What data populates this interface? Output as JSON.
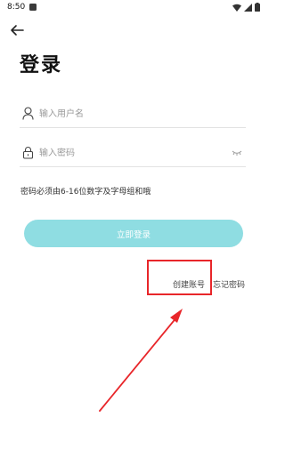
{
  "status_bar": {
    "time": "8:50"
  },
  "login": {
    "title": "登录",
    "username_placeholder": "输入用户名",
    "password_placeholder": "输入密码",
    "password_hint": "密码必须由6-16位数字及字母组和哦",
    "submit_label": "立即登录",
    "create_account_label": "创建账号",
    "forgot_password_label": "忘记密码"
  },
  "icons": {
    "back": "arrow-left-icon",
    "user": "user-icon",
    "lock": "lock-icon",
    "eye": "eye-closed-icon"
  },
  "colors": {
    "button": "#8fdde2",
    "annotation": "#e8262a"
  }
}
